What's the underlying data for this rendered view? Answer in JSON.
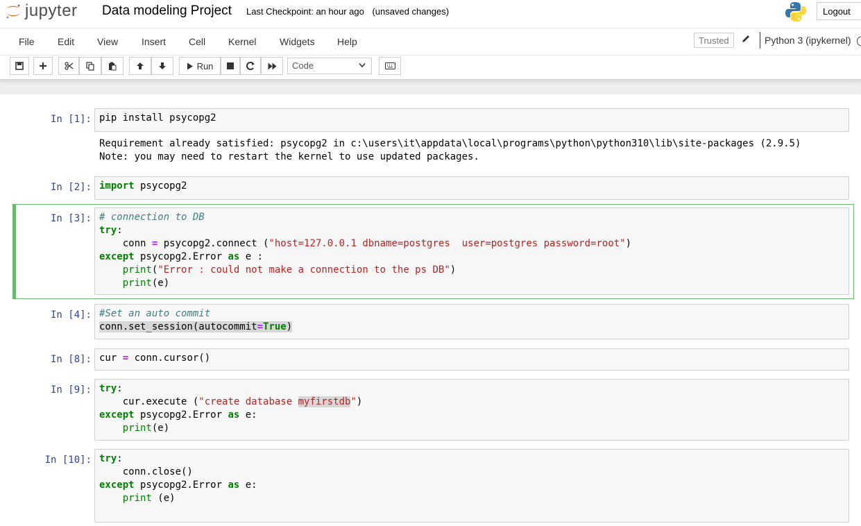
{
  "header": {
    "brand": "jupyter",
    "notebook_title": "Data modeling Project",
    "checkpoint": "Last Checkpoint: an hour ago",
    "unsaved": "(unsaved changes)",
    "logout": "Logout"
  },
  "menubar": {
    "items": [
      "File",
      "Edit",
      "View",
      "Insert",
      "Cell",
      "Kernel",
      "Widgets",
      "Help"
    ],
    "trusted": "Trusted",
    "kernel": "Python 3 (ipykernel)"
  },
  "toolbar": {
    "run_label": "Run",
    "cell_type": "Code"
  },
  "cells": [
    {
      "prompt": "In [1]:",
      "lines": [
        "pip install psycopg2"
      ],
      "output": [
        "Requirement already satisfied: psycopg2 in c:\\users\\it\\appdata\\local\\programs\\python\\python310\\lib\\site-packages (2.9.5)",
        "Note: you may need to restart the kernel to use updated packages."
      ]
    },
    {
      "prompt": "In [2]:",
      "lines": [
        "import psycopg2"
      ]
    },
    {
      "prompt": "In [3]:",
      "lines": [
        "# connection to DB",
        "try:",
        "    conn = psycopg2.connect (\"host=127.0.0.1 dbname=postgres  user=postgres password=root\")",
        "except psycopg2.Error as e :",
        "    print(\"Error : could not make a connection to the ps DB\")",
        "    print(e)"
      ]
    },
    {
      "prompt": "In [4]:",
      "lines": [
        "#Set an auto commit",
        "conn.set_session(autocommit=True)"
      ]
    },
    {
      "prompt": "In [8]:",
      "lines": [
        "cur = conn.cursor()"
      ]
    },
    {
      "prompt": "In [9]:",
      "lines": [
        "try:",
        "    cur.execute (\"create database myfirstdb\")",
        "except psycopg2.Error as e:",
        "    print(e)"
      ]
    },
    {
      "prompt": "In [10]:",
      "lines": [
        "try:",
        "    conn.close()",
        "except psycopg2.Error as e:",
        "    print (e)"
      ]
    }
  ]
}
